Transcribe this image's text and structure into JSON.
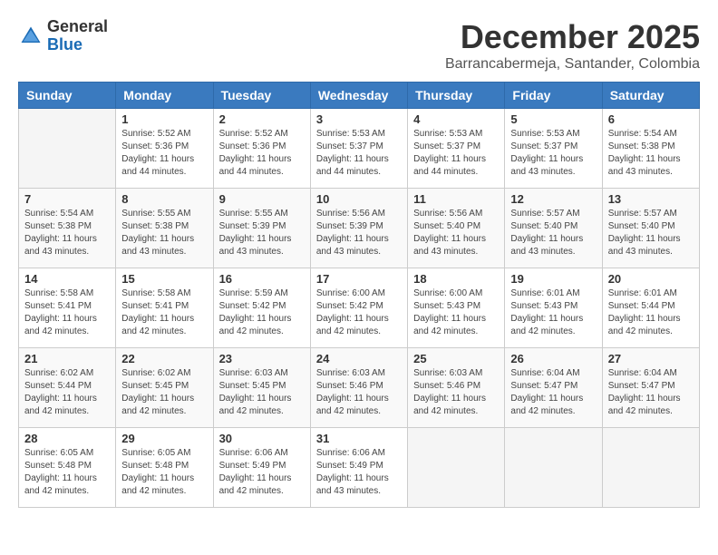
{
  "header": {
    "logo": {
      "general": "General",
      "blue": "Blue"
    },
    "title": "December 2025",
    "subtitle": "Barrancabermeja, Santander, Colombia"
  },
  "calendar": {
    "headers": [
      "Sunday",
      "Monday",
      "Tuesday",
      "Wednesday",
      "Thursday",
      "Friday",
      "Saturday"
    ],
    "weeks": [
      [
        {
          "day": "",
          "info": ""
        },
        {
          "day": "1",
          "info": "Sunrise: 5:52 AM\nSunset: 5:36 PM\nDaylight: 11 hours\nand 44 minutes."
        },
        {
          "day": "2",
          "info": "Sunrise: 5:52 AM\nSunset: 5:36 PM\nDaylight: 11 hours\nand 44 minutes."
        },
        {
          "day": "3",
          "info": "Sunrise: 5:53 AM\nSunset: 5:37 PM\nDaylight: 11 hours\nand 44 minutes."
        },
        {
          "day": "4",
          "info": "Sunrise: 5:53 AM\nSunset: 5:37 PM\nDaylight: 11 hours\nand 44 minutes."
        },
        {
          "day": "5",
          "info": "Sunrise: 5:53 AM\nSunset: 5:37 PM\nDaylight: 11 hours\nand 43 minutes."
        },
        {
          "day": "6",
          "info": "Sunrise: 5:54 AM\nSunset: 5:38 PM\nDaylight: 11 hours\nand 43 minutes."
        }
      ],
      [
        {
          "day": "7",
          "info": "Sunrise: 5:54 AM\nSunset: 5:38 PM\nDaylight: 11 hours\nand 43 minutes."
        },
        {
          "day": "8",
          "info": "Sunrise: 5:55 AM\nSunset: 5:38 PM\nDaylight: 11 hours\nand 43 minutes."
        },
        {
          "day": "9",
          "info": "Sunrise: 5:55 AM\nSunset: 5:39 PM\nDaylight: 11 hours\nand 43 minutes."
        },
        {
          "day": "10",
          "info": "Sunrise: 5:56 AM\nSunset: 5:39 PM\nDaylight: 11 hours\nand 43 minutes."
        },
        {
          "day": "11",
          "info": "Sunrise: 5:56 AM\nSunset: 5:40 PM\nDaylight: 11 hours\nand 43 minutes."
        },
        {
          "day": "12",
          "info": "Sunrise: 5:57 AM\nSunset: 5:40 PM\nDaylight: 11 hours\nand 43 minutes."
        },
        {
          "day": "13",
          "info": "Sunrise: 5:57 AM\nSunset: 5:40 PM\nDaylight: 11 hours\nand 43 minutes."
        }
      ],
      [
        {
          "day": "14",
          "info": "Sunrise: 5:58 AM\nSunset: 5:41 PM\nDaylight: 11 hours\nand 42 minutes."
        },
        {
          "day": "15",
          "info": "Sunrise: 5:58 AM\nSunset: 5:41 PM\nDaylight: 11 hours\nand 42 minutes."
        },
        {
          "day": "16",
          "info": "Sunrise: 5:59 AM\nSunset: 5:42 PM\nDaylight: 11 hours\nand 42 minutes."
        },
        {
          "day": "17",
          "info": "Sunrise: 6:00 AM\nSunset: 5:42 PM\nDaylight: 11 hours\nand 42 minutes."
        },
        {
          "day": "18",
          "info": "Sunrise: 6:00 AM\nSunset: 5:43 PM\nDaylight: 11 hours\nand 42 minutes."
        },
        {
          "day": "19",
          "info": "Sunrise: 6:01 AM\nSunset: 5:43 PM\nDaylight: 11 hours\nand 42 minutes."
        },
        {
          "day": "20",
          "info": "Sunrise: 6:01 AM\nSunset: 5:44 PM\nDaylight: 11 hours\nand 42 minutes."
        }
      ],
      [
        {
          "day": "21",
          "info": "Sunrise: 6:02 AM\nSunset: 5:44 PM\nDaylight: 11 hours\nand 42 minutes."
        },
        {
          "day": "22",
          "info": "Sunrise: 6:02 AM\nSunset: 5:45 PM\nDaylight: 11 hours\nand 42 minutes."
        },
        {
          "day": "23",
          "info": "Sunrise: 6:03 AM\nSunset: 5:45 PM\nDaylight: 11 hours\nand 42 minutes."
        },
        {
          "day": "24",
          "info": "Sunrise: 6:03 AM\nSunset: 5:46 PM\nDaylight: 11 hours\nand 42 minutes."
        },
        {
          "day": "25",
          "info": "Sunrise: 6:03 AM\nSunset: 5:46 PM\nDaylight: 11 hours\nand 42 minutes."
        },
        {
          "day": "26",
          "info": "Sunrise: 6:04 AM\nSunset: 5:47 PM\nDaylight: 11 hours\nand 42 minutes."
        },
        {
          "day": "27",
          "info": "Sunrise: 6:04 AM\nSunset: 5:47 PM\nDaylight: 11 hours\nand 42 minutes."
        }
      ],
      [
        {
          "day": "28",
          "info": "Sunrise: 6:05 AM\nSunset: 5:48 PM\nDaylight: 11 hours\nand 42 minutes."
        },
        {
          "day": "29",
          "info": "Sunrise: 6:05 AM\nSunset: 5:48 PM\nDaylight: 11 hours\nand 42 minutes."
        },
        {
          "day": "30",
          "info": "Sunrise: 6:06 AM\nSunset: 5:49 PM\nDaylight: 11 hours\nand 42 minutes."
        },
        {
          "day": "31",
          "info": "Sunrise: 6:06 AM\nSunset: 5:49 PM\nDaylight: 11 hours\nand 43 minutes."
        },
        {
          "day": "",
          "info": ""
        },
        {
          "day": "",
          "info": ""
        },
        {
          "day": "",
          "info": ""
        }
      ]
    ]
  }
}
